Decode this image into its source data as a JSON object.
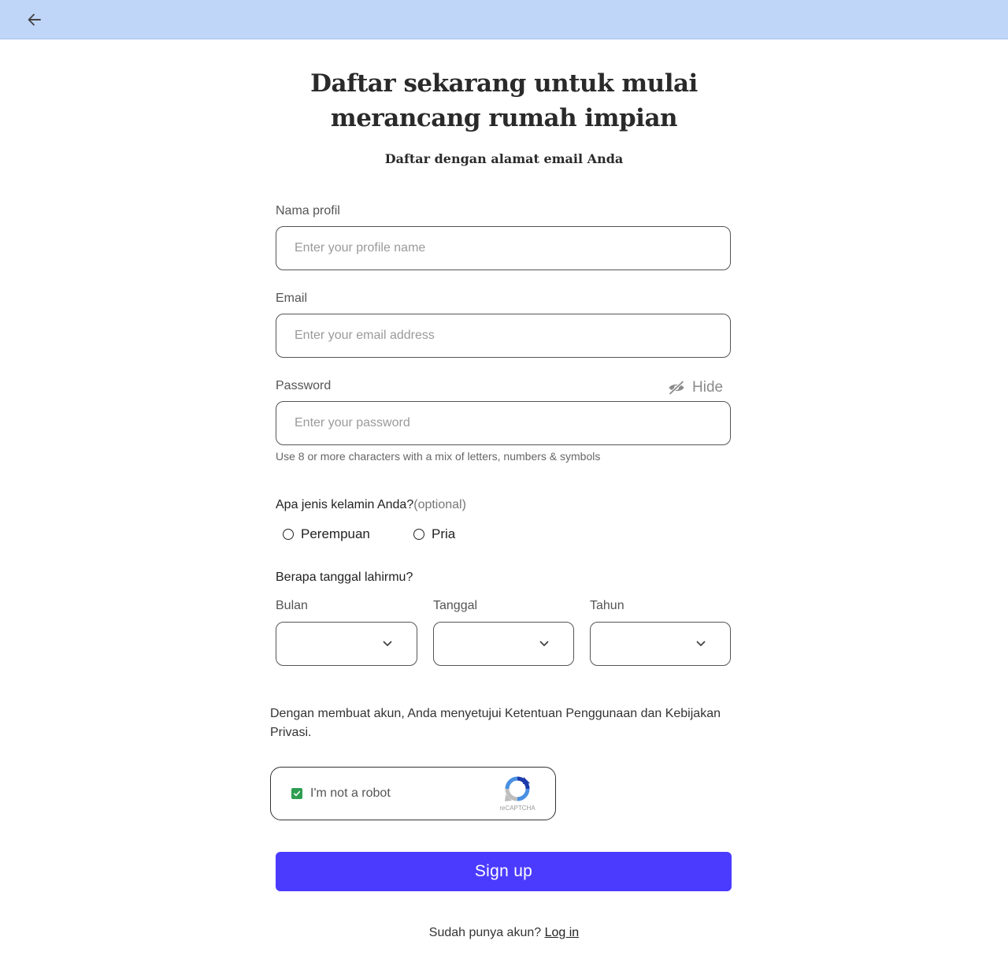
{
  "header": {
    "back_icon": "arrow-left-icon",
    "bg_color": "#bfd6f8"
  },
  "page": {
    "title": "Daftar sekarang untuk mulai merancang rumah impian",
    "subtitle": "Daftar dengan alamat email Anda"
  },
  "form": {
    "profile": {
      "label": "Nama profil",
      "placeholder": "Enter your profile name",
      "value": ""
    },
    "email": {
      "label": "Email",
      "placeholder": "Enter your email address",
      "value": ""
    },
    "password": {
      "label": "Password",
      "placeholder": "Enter your password",
      "value": "",
      "toggle_label": "Hide",
      "toggle_icon": "eye-slash-icon",
      "hint": "Use 8 or more characters with a mix of letters, numbers & symbols"
    },
    "gender": {
      "question": "Apa jenis kelamin Anda?",
      "optional": "(optional)",
      "options": [
        "Perempuan",
        "Pria"
      ],
      "selected": null
    },
    "birthdate": {
      "question": "Berapa tanggal lahirmu?",
      "month_label": "Bulan",
      "day_label": "Tanggal",
      "year_label": "Tahun",
      "month_value": "",
      "day_value": "",
      "year_value": "",
      "dropdown_icon": "chevron-down-icon"
    },
    "terms": "Dengan membuat akun, Anda menyetujui Ketentuan Penggunaan dan Kebijakan Privasi.",
    "captcha": {
      "label": "I'm not a robot",
      "checked": true,
      "brand": "reCAPTCHA",
      "check_color": "#2e9e52"
    },
    "submit_label": "Sign up",
    "submit_color": "#4b3bff"
  },
  "footer": {
    "prompt": "Sudah punya akun?",
    "login_link": "Log in"
  }
}
